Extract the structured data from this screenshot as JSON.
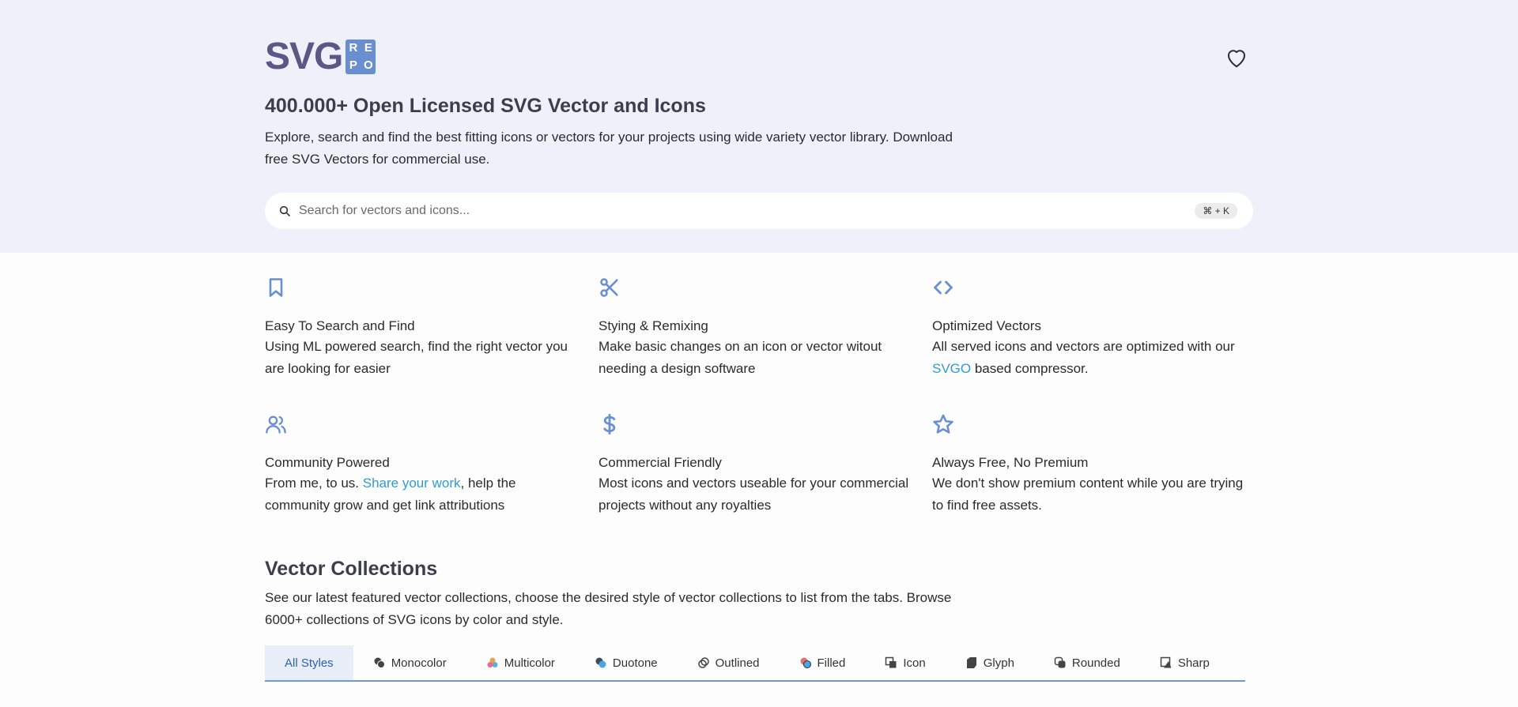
{
  "logo": {
    "main": "SVG",
    "box": [
      "R",
      "E",
      "P",
      "O"
    ]
  },
  "hero": {
    "title": "400.000+ Open Licensed SVG Vector and Icons",
    "description": "Explore, search and find the best fitting icons or vectors for your projects using wide variety vector library. Download free SVG Vectors for commercial use."
  },
  "search": {
    "placeholder": "Search for vectors and icons...",
    "shortcut": "⌘ + K"
  },
  "features": [
    {
      "icon": "bookmark-icon",
      "title": "Easy To Search and Find",
      "desc": "Using ML powered search, find the right vector you are looking for easier"
    },
    {
      "icon": "scissors-icon",
      "title": "Stying & Remixing",
      "desc": "Make basic changes on an icon or vector witout needing a design software"
    },
    {
      "icon": "code-icon",
      "title": "Optimized Vectors",
      "desc_pre": "All served icons and vectors are optimized with our ",
      "link": "SVGO",
      "desc_post": " based compressor."
    },
    {
      "icon": "users-icon",
      "title": "Community Powered",
      "desc_pre": "From me, to us. ",
      "link": "Share your work",
      "desc_post": ", help the community grow and get link attributions"
    },
    {
      "icon": "dollar-icon",
      "title": "Commercial Friendly",
      "desc": "Most icons and vectors useable for your commercial projects without any royalties"
    },
    {
      "icon": "star-icon",
      "title": "Always Free, No Premium",
      "desc": "We don't show premium content while you are trying to find free assets."
    }
  ],
  "collections": {
    "title": "Vector Collections",
    "description": "See our latest featured vector collections, choose the desired style of vector collections to list from the tabs. Browse 6000+ collections of SVG icons by color and style.",
    "tabs": [
      "All Styles",
      "Monocolor",
      "Multicolor",
      "Duotone",
      "Outlined",
      "Filled",
      "Icon",
      "Glyph",
      "Rounded",
      "Sharp"
    ]
  },
  "colors": {
    "accent": "#6a8fd1",
    "link": "#2f9cd1",
    "hero_bg": "#eff1fa",
    "logo": "#5b5887"
  }
}
